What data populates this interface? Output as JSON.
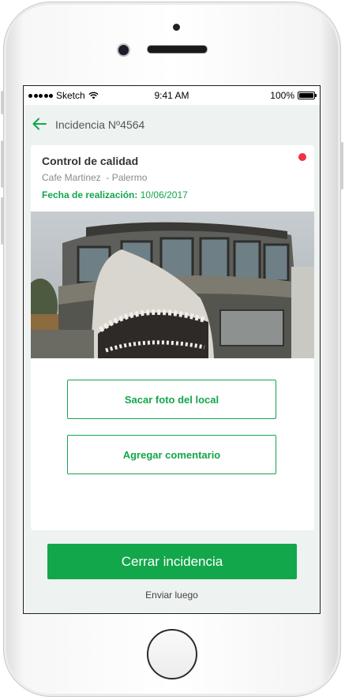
{
  "status_bar": {
    "carrier": "Sketch",
    "time": "9:41 AM",
    "battery": "100%"
  },
  "nav": {
    "title": "Incidencia Nº4564",
    "back_icon": "arrow-left-icon"
  },
  "card": {
    "title": "Control de calidad",
    "subtitle": "Cafe Martinez  - Palermo",
    "date_label": "Fecha de realización:",
    "date_value": "10/06/2017",
    "status_color": "#f03246"
  },
  "actions": {
    "take_photo": "Sacar foto del local",
    "add_comment": "Agregar comentario"
  },
  "footer": {
    "close_label": "Cerrar incidencia",
    "later_label": "Enviar luego"
  },
  "colors": {
    "accent": "#12a74a",
    "background": "#eef2f1"
  }
}
